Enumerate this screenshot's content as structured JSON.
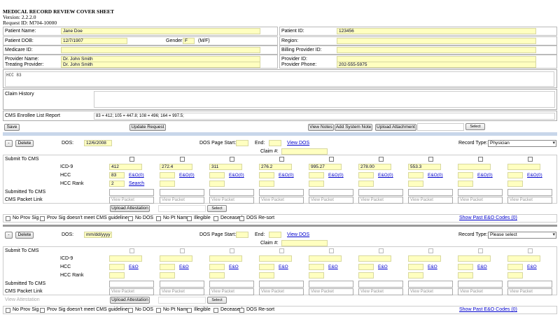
{
  "header": {
    "title": "MEDICAL RECORD REVIEW COVER SHEET",
    "version": "Version: 2.2.2.0",
    "request": "Request ID: M704-10000"
  },
  "patient": {
    "name_label": "Patient Name:",
    "name": "Jane Doe",
    "id_label": "Patient ID:",
    "id": "123456",
    "dob_label": "Patient DOB:",
    "dob": "12/7/1907",
    "gender_label": "Gender:",
    "gender": "F",
    "gender_hint": "(M/F)",
    "region_label": "Region:",
    "medicare_label": "Medicare ID:",
    "billing_label": "Billing Provider ID:",
    "provider_name_label": "Provider Name:",
    "provider_name": "Dr. John Smith",
    "treating_label": "Treating Provider:",
    "treating": "Dr. John Smith",
    "provider_id_label": "Provider ID:",
    "provider_phone_label": "Provider Phone:",
    "provider_phone": "202-555-5975"
  },
  "hcc_box": "HCC 83",
  "claim_history_label": "Claim History",
  "cms_enrollee_label": "CMS Enrollee List Report",
  "cms_enrollee_value": "83 = 412; 105 = 447.8; 108 = 496; 164 = 997.5;",
  "toolbar": {
    "save": "Save",
    "update": "Update Request",
    "view_notes": "View Notes",
    "add_note": "Add System Note",
    "upload": "Upload Attachment",
    "select": "Select"
  },
  "section1": {
    "minus": "-",
    "delete": "Delete",
    "dos_label": "DOS:",
    "dos": "12/6/2008",
    "page_start_label": "DOS Page Start:",
    "end_label": "End:",
    "view_dos": "View DOS",
    "claim_label": "Claim #:",
    "record_type_label": "Record Type:",
    "record_type": "Physician",
    "submit_label": "Submit To CMS",
    "icd_label": "ICD-9",
    "hcc_label": "HCC",
    "rank_label": "HCC Rank",
    "submitted_label": "Submitted To CMS",
    "packet_label": "CMS Packet Link",
    "icd": [
      "412",
      "272.4",
      "311",
      "276.2",
      "995.27",
      "278.00",
      "553.3",
      "",
      ""
    ],
    "hcc": [
      "83",
      "",
      "",
      "",
      "",
      "",
      "",
      "",
      ""
    ],
    "eo": [
      "E&O(0)",
      "E&O(0)",
      "E&O(0)",
      "E&O(0)",
      "E&O(0)",
      "E&O(0)",
      "E&O(0)",
      "E&O(0)",
      "E&O(0)"
    ],
    "rank": "2",
    "search": "Search",
    "view_packet": "View Packet",
    "upload_attestation": "Upload Attestation",
    "select": "Select",
    "past_codes": "Show Past E&O Codes (0)"
  },
  "section2": {
    "minus": "-",
    "delete": "Delete",
    "dos_label": "DOS:",
    "dos": "mm/dd/yyyy",
    "page_start_label": "DOS Page Start:",
    "end_label": "End:",
    "view_dos": "View DOS",
    "claim_label": "Claim #:",
    "record_type_label": "Record Type:",
    "record_type": "Please select",
    "submit_label": "Submit To CMS",
    "icd_label": "ICD-9",
    "hcc_label": "HCC",
    "rank_label": "HCC Rank",
    "submitted_label": "Submitted To CMS",
    "packet_label": "CMS Packet Link",
    "eo": [
      "E&O",
      "E&O",
      "E&O",
      "E&O",
      "E&O",
      "E&O",
      "E&O",
      "E&O",
      "E&O"
    ],
    "view_packet": "View Packet",
    "view_attestation": "View Attestation",
    "upload_attestation": "Upload Attestation",
    "select": "Select",
    "past_codes": "Show Past E&O Codes (0)"
  },
  "checks": [
    "No Prov Sig",
    "Prov Sig doesn't meet CMS guidelines",
    "No DOS",
    "No Pt Name",
    "Illegible",
    "Deceased",
    "DOS Re-sort"
  ]
}
